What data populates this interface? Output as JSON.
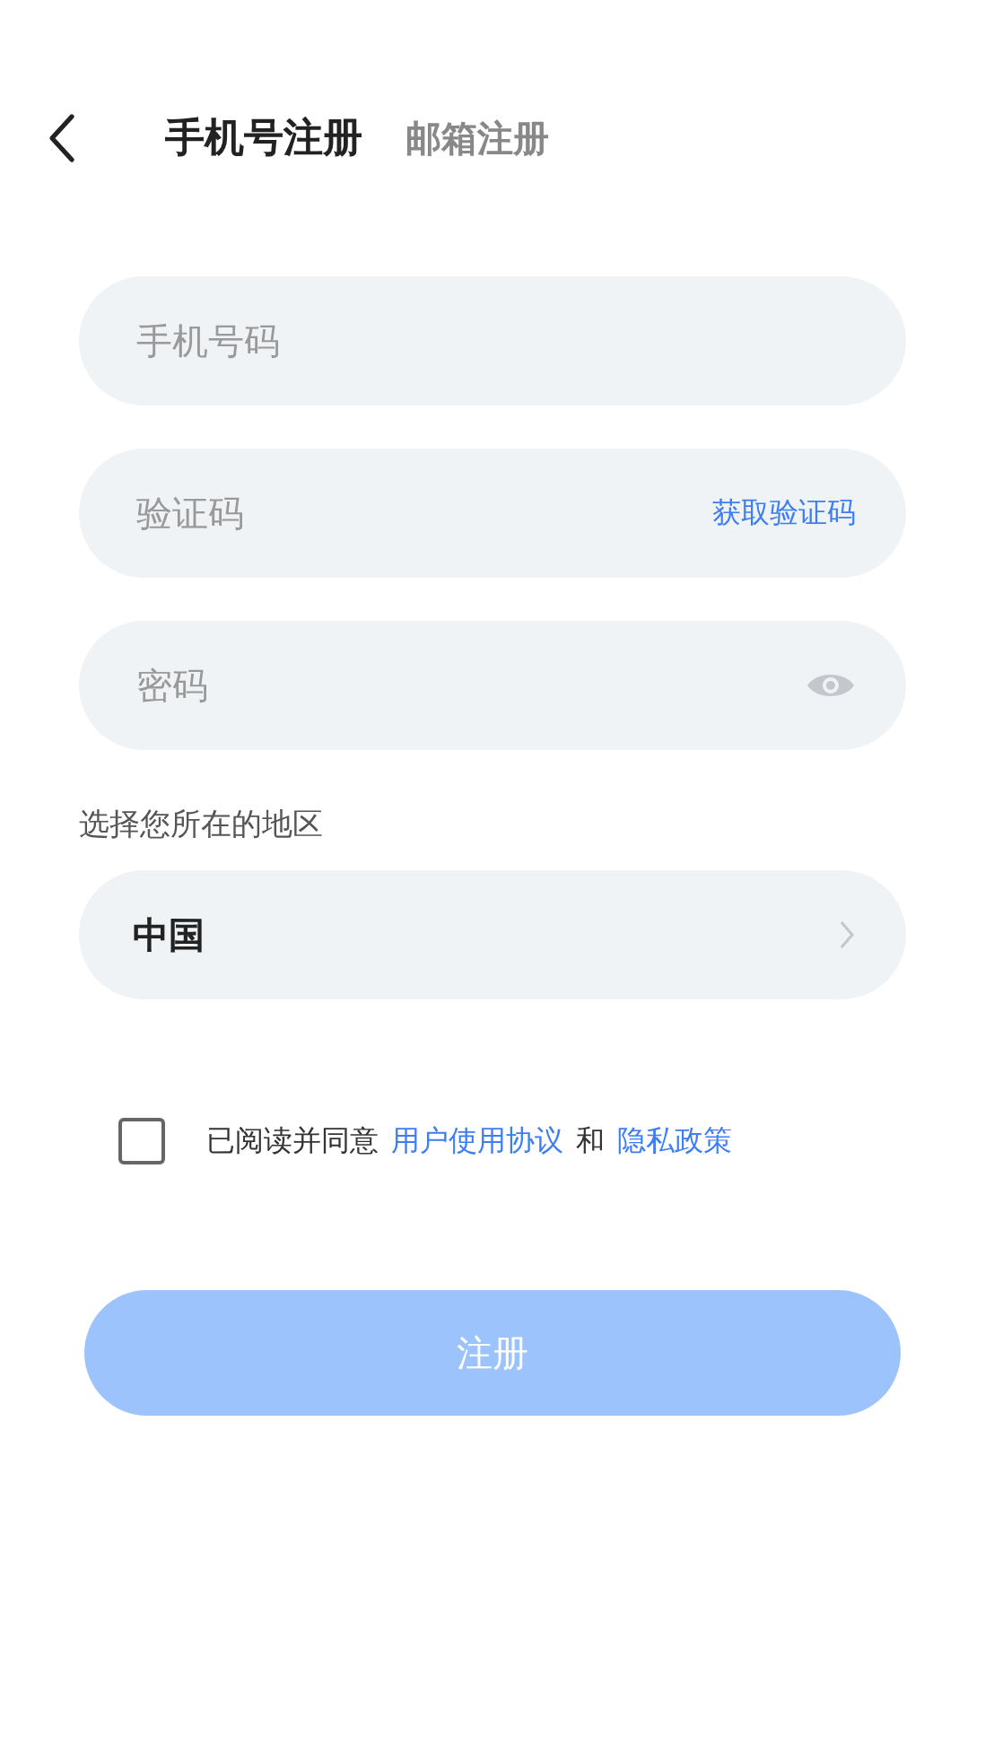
{
  "header": {
    "tabs": [
      {
        "label": "手机号注册",
        "selected": true
      },
      {
        "label": "邮箱注册",
        "selected": false
      }
    ]
  },
  "fields": [
    {
      "kind": "input",
      "placeholder": "手机号码"
    },
    {
      "kind": "code",
      "placeholder": "验证码",
      "action": "获取验证码"
    },
    {
      "kind": "password",
      "placeholder": "密码"
    }
  ],
  "region": {
    "label": "选择您所在的地区",
    "value": "中国"
  },
  "agreement": {
    "checked": false,
    "prefix": "已阅读并同意",
    "link_1": "用户使用协议",
    "joiner": "和",
    "link_2": "隐私政策"
  },
  "submit": {
    "label": "注册",
    "disabled": true
  }
}
